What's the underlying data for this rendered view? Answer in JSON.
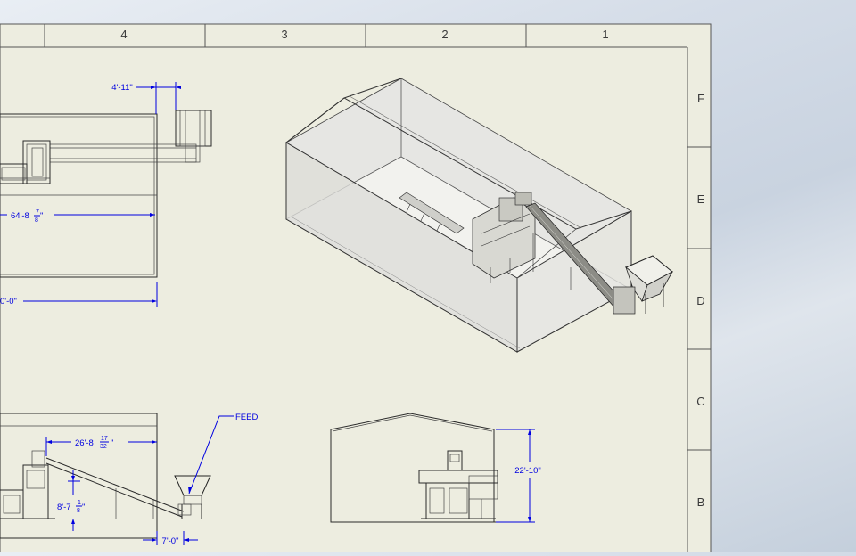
{
  "zones_top": [
    "4",
    "3",
    "2",
    "1"
  ],
  "zones_right": [
    "F",
    "E",
    "D",
    "C",
    "B"
  ],
  "dimensions": {
    "top_small": "4'-11\"",
    "long_main": "64'-8",
    "long_main_num": "7",
    "long_main_den": "8",
    "long_main_suffix": "\"",
    "overall_partial": "0'-0\"",
    "side_run": "26'-8",
    "side_run_num": "17",
    "side_run_den": "32",
    "side_run_suffix": "\"",
    "side_height": "8'-7",
    "side_height_num": "1",
    "side_height_den": "8",
    "side_height_suffix": "\"",
    "hopper_width": "7'-0\"",
    "end_height": "22'-10\""
  },
  "callouts": {
    "feed": "FEED"
  }
}
